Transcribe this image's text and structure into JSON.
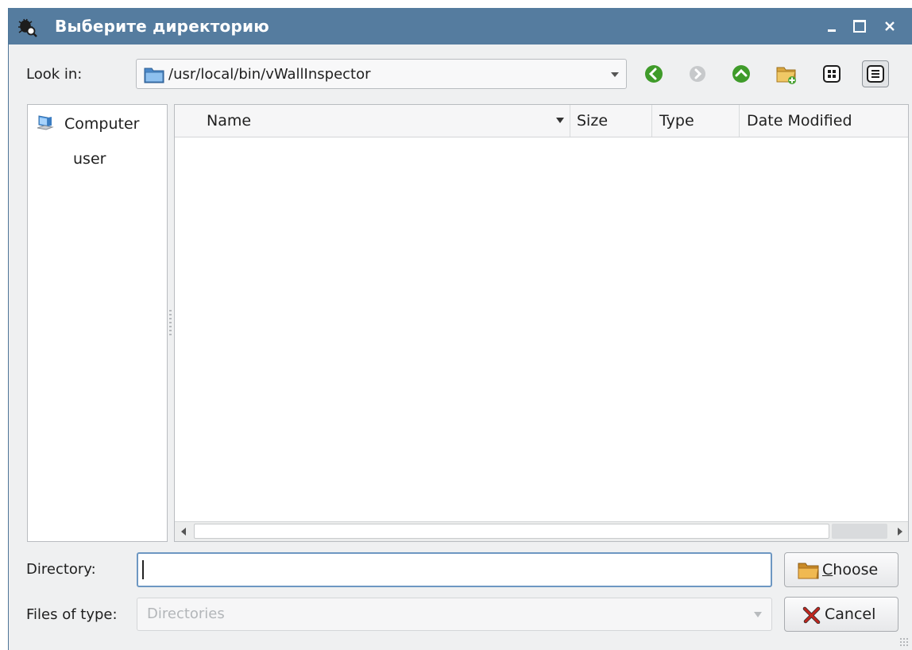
{
  "window": {
    "title": "Выберите директорию",
    "controls": {
      "minimize": "minimize",
      "maximize": "maximize",
      "close": "close"
    }
  },
  "look_in": {
    "label": "Look in:",
    "path": "/usr/local/bin/vWallInspector"
  },
  "toolbar": {
    "icons": [
      "back-icon",
      "forward-icon",
      "parent-directory-icon",
      "new-folder-icon",
      "list-view-icon",
      "detail-view-icon"
    ]
  },
  "sidebar": {
    "items": [
      {
        "label": "Computer",
        "icon": "computer-icon"
      },
      {
        "label": "user"
      }
    ]
  },
  "file_list": {
    "columns": [
      "Name",
      "Size",
      "Type",
      "Date Modified"
    ],
    "rows": []
  },
  "directory": {
    "label": "Directory:",
    "value": ""
  },
  "files_of_type": {
    "label": "Files of type:",
    "value": "Directories"
  },
  "buttons": {
    "choose_prefix": "",
    "choose_mnemonic": "C",
    "choose_rest": "hoose",
    "cancel": "Cancel"
  },
  "colors": {
    "titlebar": "#557c9f",
    "focus_border": "#6d97c2",
    "back_green": "#3f9b2a"
  }
}
